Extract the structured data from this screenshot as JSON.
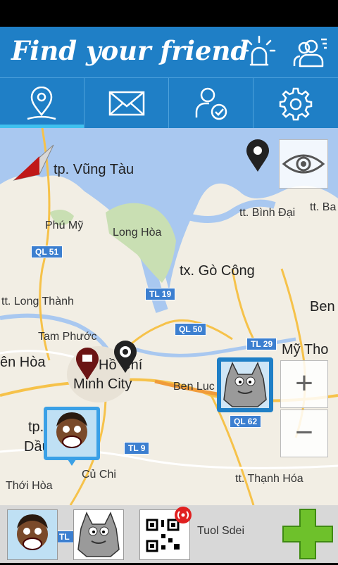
{
  "app": {
    "title": "Find your friend"
  },
  "header": {
    "icons": [
      "alarm-light-icon",
      "users-list-icon"
    ]
  },
  "tabs": [
    {
      "name": "map",
      "icon": "location-pin-icon",
      "active": true
    },
    {
      "name": "messages",
      "icon": "envelope-icon",
      "active": false
    },
    {
      "name": "friends",
      "icon": "user-check-icon",
      "active": false
    },
    {
      "name": "settings",
      "icon": "gear-icon",
      "active": false
    }
  ],
  "map": {
    "labels": {
      "vung_tau": "tp. Vũng Tàu",
      "binh_dai": "tt. Bình Đại",
      "ba": "tt. Ba",
      "phu_my": "Phú Mỹ",
      "long_hoa": "Long Hòa",
      "go_cong": "tx. Gò Công",
      "ben_tre": "Ben T",
      "long_thanh": "tt. Long Thành",
      "tam_phuoc": "Tam Phước",
      "bien_hoa": "ên Hòa",
      "city_top": "Hồ Chí",
      "city_bottom": "Minh City",
      "my_tho": "Mỹ Tho",
      "ben_luc": "Ben Luc",
      "tp": "tp.",
      "di_an": "Dầu",
      "cu_chi": "Củ Chi",
      "thoi_hoa": "Thới Hòa",
      "thanh_hoa": "tt. Thạnh Hóa",
      "tuol_sdei": "Tuol Sdei"
    },
    "roads": {
      "ql51": "QL 51",
      "tl19": "TL 19",
      "ql50": "QL 50",
      "tl29": "TL 29",
      "ql62": "QL 62",
      "tl9": "TL 9",
      "tl": "TL"
    },
    "controls": {
      "zoom_in": "+",
      "zoom_out": "−"
    }
  },
  "colors": {
    "header": "#1f7fc6",
    "tab_active": "#3fc1ef",
    "add": "#6ec12b",
    "alert": "#e02020"
  }
}
